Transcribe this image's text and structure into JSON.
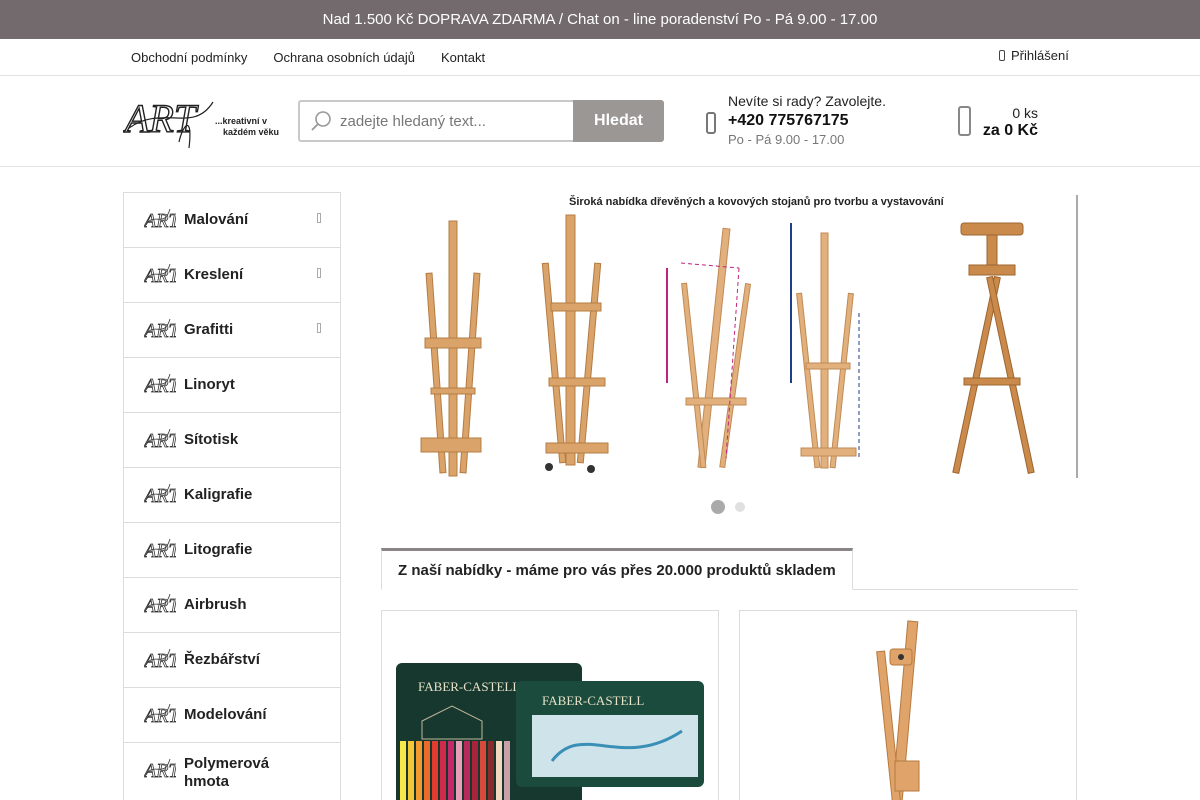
{
  "topbar": {
    "text": "Nad 1.500 Kč DOPRAVA ZDARMA / Chat on - line poradenství Po - Pá 9.00 - 17.00"
  },
  "nav": {
    "links": [
      "Obchodní podmínky",
      "Ochrana osobních údajů",
      "Kontakt"
    ],
    "login": "Přihlášení"
  },
  "header": {
    "logo_text": "ART",
    "logo_tagline_1": "...kreativní v",
    "logo_tagline_2": "každém věku",
    "search_placeholder": "zadejte hledaný text...",
    "search_button": "Hledat",
    "contact_question": "Nevíte si rady? Zavolejte.",
    "contact_phone": "+420 775767175",
    "contact_hours": "Po - Pá 9.00 - 17.00",
    "cart_count": "0 ks",
    "cart_total": "za 0 Kč"
  },
  "sidebar": {
    "items": [
      {
        "label": "Malování",
        "has_submenu": true
      },
      {
        "label": "Kreslení",
        "has_submenu": true
      },
      {
        "label": "Grafitti",
        "has_submenu": true
      },
      {
        "label": "Linoryt",
        "has_submenu": false
      },
      {
        "label": "Sítotisk",
        "has_submenu": false
      },
      {
        "label": "Kaligrafie",
        "has_submenu": false
      },
      {
        "label": "Litografie",
        "has_submenu": false
      },
      {
        "label": "Airbrush",
        "has_submenu": false
      },
      {
        "label": "Řezbářství",
        "has_submenu": false
      },
      {
        "label": "Modelování",
        "has_submenu": false
      },
      {
        "label": "Polymerová hmota",
        "has_submenu": false
      }
    ]
  },
  "banner": {
    "caption": "Široká nabídka dřevěných a kovových stojanů pro tvorbu a vystavování",
    "slides": 2,
    "active_slide": 1
  },
  "tabs": {
    "active": "Z naší nabídky - máme pro vás přes 20.000 produktů skladem"
  },
  "products": {
    "p1": {
      "brand_1": "FABER-CASTELL",
      "brand_2": "FABER-CASTELL"
    }
  },
  "colors": {
    "topbar": "#736a6e",
    "button": "#9b9795",
    "border": "#dcdcdc",
    "wood": "#d9a36a"
  }
}
